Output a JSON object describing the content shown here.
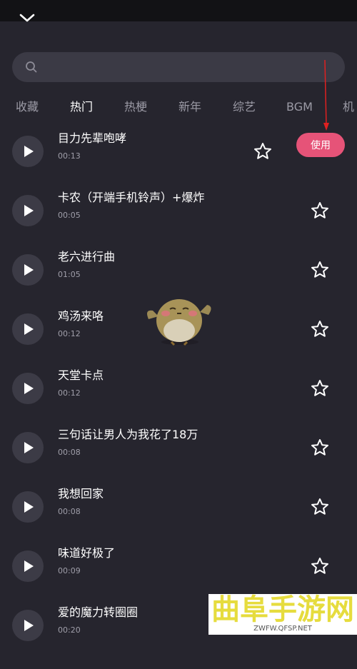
{
  "search": {
    "placeholder": ""
  },
  "tabs": [
    {
      "label": "收藏"
    },
    {
      "label": "热门"
    },
    {
      "label": "热梗"
    },
    {
      "label": "新年"
    },
    {
      "label": "综艺"
    },
    {
      "label": "BGM"
    },
    {
      "label": "机"
    }
  ],
  "songs": [
    {
      "title": "目力先辈咆哮",
      "duration": "00:13",
      "use_label": "使用"
    },
    {
      "title": "卡农（开端手机铃声）+爆炸",
      "duration": "00:05"
    },
    {
      "title": "老六进行曲",
      "duration": "01:05"
    },
    {
      "title": "鸡汤来咯",
      "duration": "00:12"
    },
    {
      "title": "天堂卡点",
      "duration": "00:12"
    },
    {
      "title": "三句话让男人为我花了18万",
      "duration": "00:08"
    },
    {
      "title": "我想回家",
      "duration": "00:08"
    },
    {
      "title": "味道好极了",
      "duration": "00:09"
    },
    {
      "title": "爱的魔力转圈圈",
      "duration": "00:20"
    }
  ],
  "watermark": {
    "title": "曲阜手游网",
    "url": "ZWFW.QFSP.NET"
  },
  "colors": {
    "background": "#26252e",
    "accent": "#e65378",
    "annotation_arrow": "#e02020"
  }
}
